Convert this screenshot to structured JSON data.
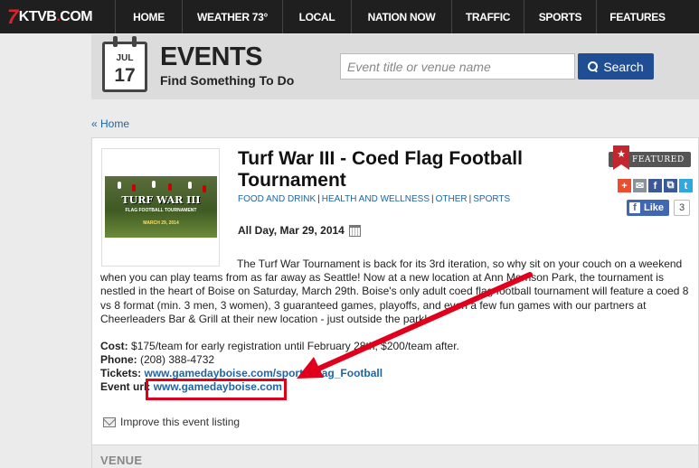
{
  "site": {
    "logo_seven": "7",
    "logo_text": "KTVB",
    "logo_dot": ".",
    "logo_com": "COM"
  },
  "nav": {
    "items": [
      {
        "label": "HOME"
      },
      {
        "label": "WEATHER 73°"
      },
      {
        "label": "LOCAL"
      },
      {
        "label": "NATION NOW"
      },
      {
        "label": "TRAFFIC"
      },
      {
        "label": "SPORTS"
      },
      {
        "label": "FEATURES"
      }
    ]
  },
  "events_header": {
    "cal_month": "JUL",
    "cal_day": "17",
    "title": "EVENTS",
    "subtitle": "Find Something To Do",
    "search_placeholder": "Event title or venue name",
    "search_button": "Search"
  },
  "breadcrumb": {
    "home": "« Home"
  },
  "event": {
    "thumb_title": "TURF WAR III",
    "thumb_sub": "FLAG FOOTBALL TOURNAMENT",
    "thumb_date": "MARCH 29, 2014",
    "title": "Turf War III - Coed Flag Football Tournament",
    "categories": [
      "FOOD AND DRINK",
      "HEALTH AND WELLNESS",
      "OTHER",
      "SPORTS"
    ],
    "category_sep": "|",
    "date": "All Day, Mar 29, 2014",
    "description": "The Turf War Tournament is back for its 3rd iteration, so why sit on your couch on a weekend when you can play teams from as far away as Seattle! Now at a new location at Ann Morrison Park, the tournament is nestled in the heart of Boise on Saturday, March 29th. Boise's only adult coed flag football tournament will feature a coed 8 vs 8 format (min. 3 men, 3 women), 3 guaranteed games, playoffs, and even a few fun games with our partners at Cheerleaders Bar & Grill at their new location - just outside the park!",
    "cost_label": "Cost:",
    "cost": "$175/team for early registration until February 28th, $200/team after.",
    "phone_label": "Phone:",
    "phone": "(208) 388-4732",
    "tickets_label": "Tickets:",
    "tickets_url": "www.gamedayboise.com/sports/Flag_Football",
    "event_url_label": "Event url:",
    "event_url": "www.gamedayboise.com",
    "improve": "Improve this event listing",
    "venue_label": "VENUE",
    "featured": "FEATURED",
    "like_label": "Like",
    "like_count": "3"
  },
  "social": {
    "icons": [
      "plus-icon",
      "email-icon",
      "facebook-icon",
      "delicious-icon",
      "twitter-icon"
    ],
    "colors": {
      "plus": "#e84e2f",
      "email": "#8a9399",
      "facebook": "#3b5998",
      "delicious": "#3b5998",
      "twitter": "#2fa8e0"
    }
  },
  "annotation": {
    "color": "#e0001b"
  }
}
